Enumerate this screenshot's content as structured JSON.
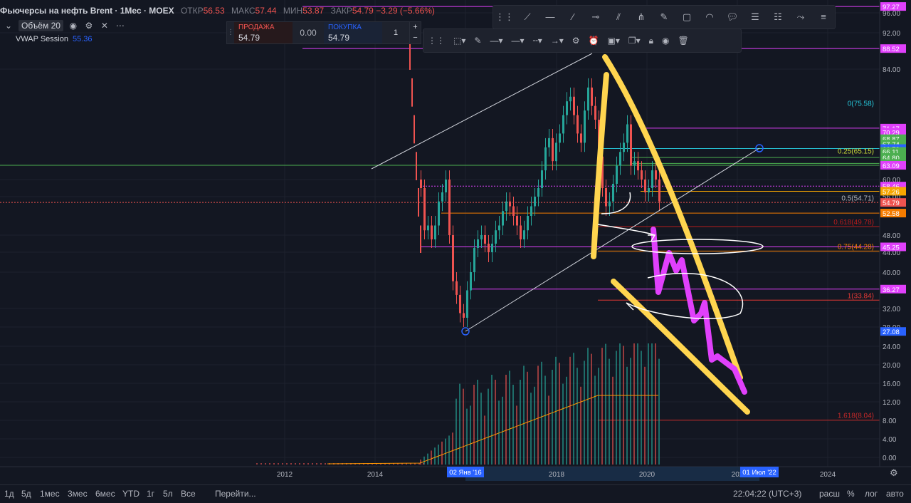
{
  "header": {
    "symbol": "Фьючерсы на нефть Brent · 1Мес · MOEX",
    "open_label": "ОТКР",
    "open": "56.53",
    "high_label": "МАКС",
    "high": "57.44",
    "low_label": "МИН",
    "low": "53.87",
    "close_label": "ЗАКР",
    "close": "54.79",
    "change": "−3.29 (−5.66%)"
  },
  "indicator": {
    "volume_label": "Объём 20",
    "vwap_label": "VWAP Session",
    "vwap_value": "55.36"
  },
  "trade_panel": {
    "sell_label": "ПРОДАЖА",
    "sell_price": "54.79",
    "spread": "0.00",
    "buy_label": "ПОКУПКА",
    "buy_price": "54.79",
    "quantity": "1",
    "plus": "+",
    "minus": "−"
  },
  "price_axis": {
    "ticks": [
      "96.00",
      "92.00",
      "84.00",
      "60.00",
      "56.00",
      "48.00",
      "44.00",
      "40.00",
      "32.00",
      "28.00",
      "24.00",
      "20.00",
      "16.00",
      "12.00",
      "8.00",
      "4.00",
      "0.00"
    ],
    "labels": [
      {
        "text": "97.27",
        "color": "#e040fb",
        "price": 97.27
      },
      {
        "text": "88.52",
        "color": "#e040fb",
        "price": 88.52
      },
      {
        "text": "71.17",
        "color": "#e040fb",
        "price": 71.17
      },
      {
        "text": "70.29",
        "color": "#e040fb",
        "price": 70.29
      },
      {
        "text": "68.87",
        "color": "#4caf50",
        "price": 68.87
      },
      {
        "text": "67.74",
        "color": "#4caf50",
        "price": 67.74
      },
      {
        "text": "66.73",
        "color": "#2962ff",
        "price": 66.73
      },
      {
        "text": "66.11",
        "color": "#4caf50",
        "price": 66.11
      },
      {
        "text": "64.80",
        "color": "#4caf50",
        "price": 64.8
      },
      {
        "text": "63.51",
        "color": "#4caf50",
        "price": 63.51
      },
      {
        "text": "63.09",
        "color": "#e040fb",
        "price": 63.09
      },
      {
        "text": "58.46",
        "color": "#e040fb",
        "price": 58.46
      },
      {
        "text": "57.26",
        "color": "#f7a600",
        "price": 57.26
      },
      {
        "text": "54.79",
        "color": "#ef5350",
        "price": 54.79
      },
      {
        "text": "52.58",
        "color": "#f57c00",
        "price": 52.58
      },
      {
        "text": "45.25",
        "color": "#e040fb",
        "price": 45.25
      },
      {
        "text": "36.27",
        "color": "#e040fb",
        "price": 36.27
      },
      {
        "text": "27.08",
        "color": "#2962ff",
        "price": 27.08
      }
    ]
  },
  "fib_levels": [
    {
      "label": "0(75.58)",
      "price": 75.58,
      "color": "#26c6da"
    },
    {
      "label": "0.25(65.15)",
      "price": 65.15,
      "color": "#cddc39"
    },
    {
      "label": "0.5(54.71)",
      "price": 54.71,
      "color": "#b2b5be"
    },
    {
      "label": "0.618(49.78)",
      "price": 49.78,
      "color": "#b71c1c"
    },
    {
      "label": "0.75(44.28)",
      "price": 44.28,
      "color": "#f57c00"
    },
    {
      "label": "1(33.84)",
      "price": 33.84,
      "color": "#e53935"
    },
    {
      "label": "1.618(8.04)",
      "price": 8.04,
      "color": "#c62828"
    }
  ],
  "time_axis": {
    "ticks": [
      "2012",
      "2014",
      "2018",
      "2020",
      "202",
      "2024"
    ],
    "badge_start": "02 Янв '16",
    "badge_end": "01 Июл '22"
  },
  "bottom_bar": {
    "timeframes": [
      "1д",
      "5д",
      "1мес",
      "3мес",
      "6мес",
      "YTD",
      "1г",
      "5л",
      "Все"
    ],
    "goto": "Перейти...",
    "clock": "22:04:22 (UTC+3)",
    "scale": "расш",
    "percent": "%",
    "log": "лог",
    "auto": "авто"
  },
  "icons": {
    "trade_grip": "grip-icon",
    "settings": "gear-icon",
    "eye": "eye-icon",
    "close": "close-icon",
    "more": "more-icon",
    "lock": "lock-icon",
    "trash": "trash-icon"
  }
}
